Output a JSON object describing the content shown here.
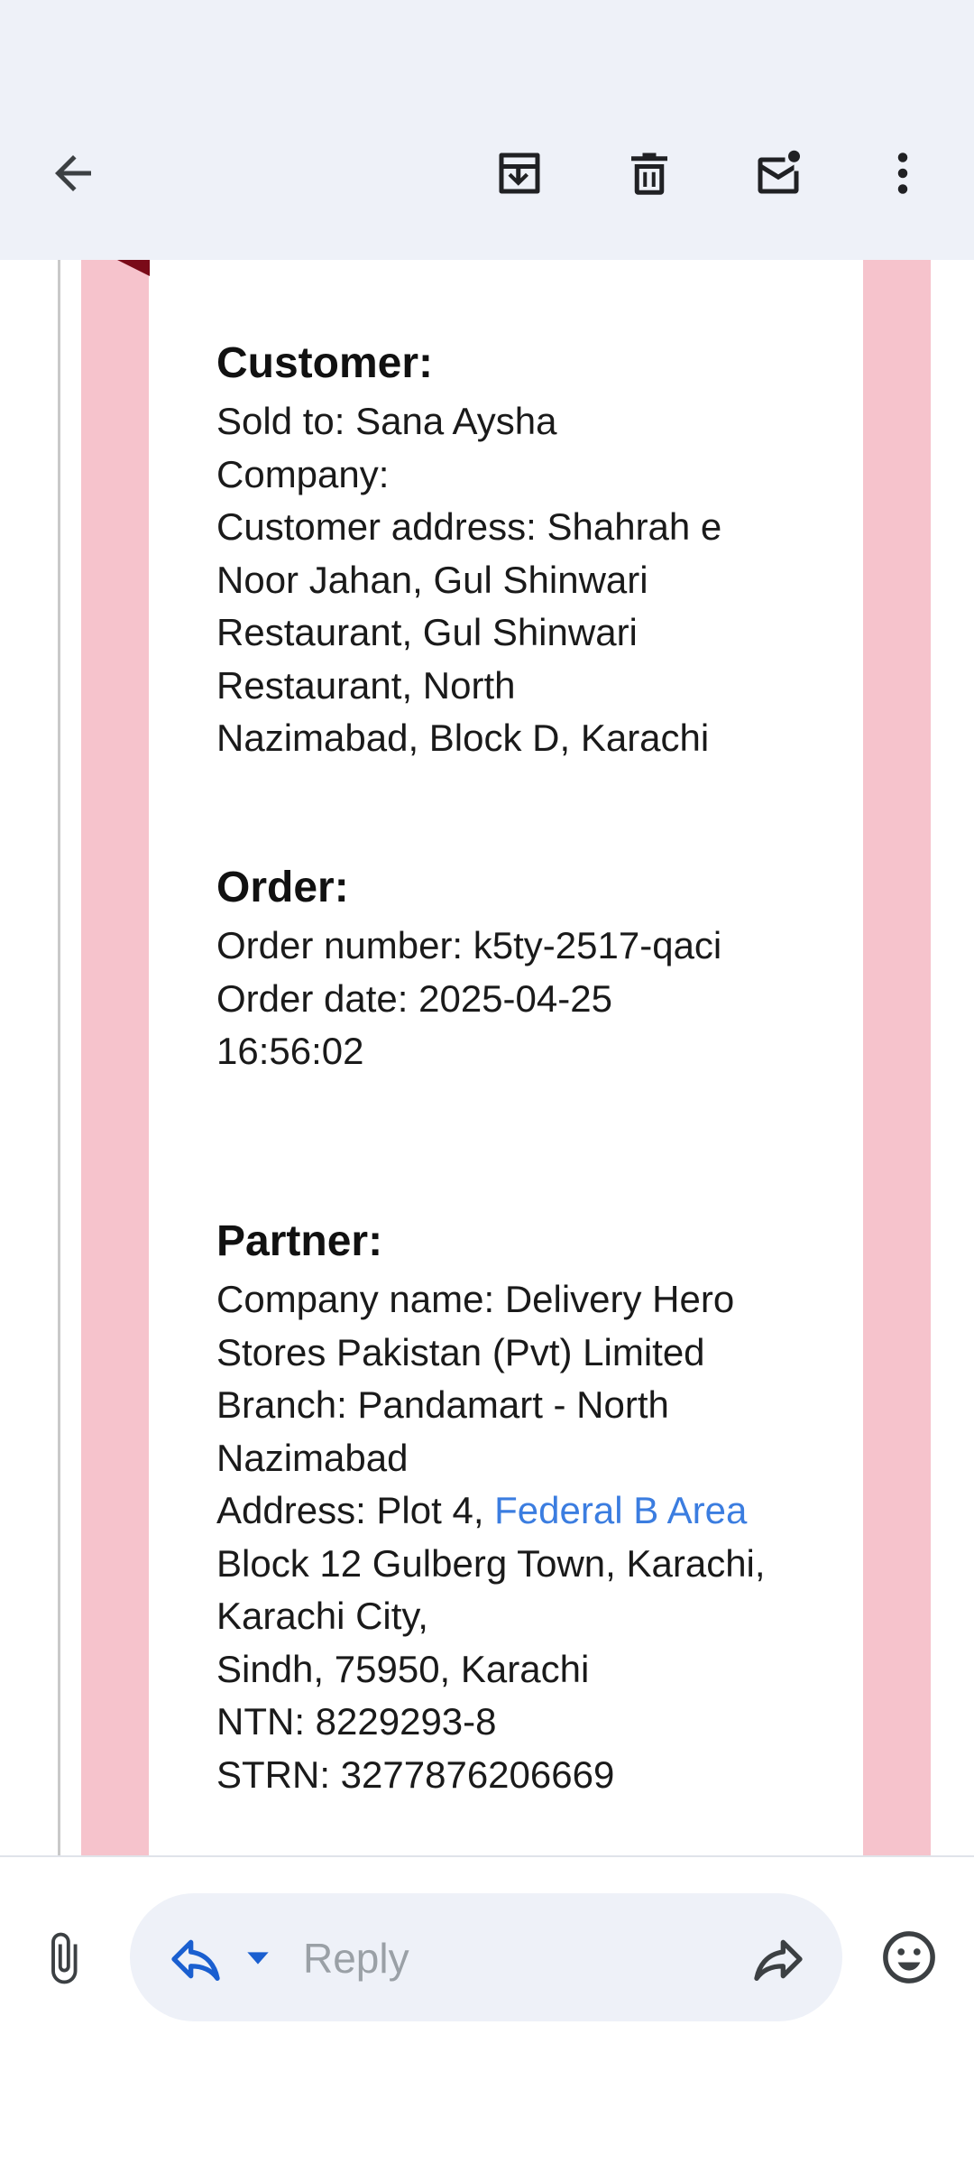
{
  "toolbar": {
    "back_icon": "arrow-back-icon",
    "archive_icon": "archive-icon",
    "delete_icon": "trash-icon",
    "mark_unread_icon": "mail-unread-icon",
    "more_icon": "more-vert-icon"
  },
  "email": {
    "customer": {
      "heading": "Customer:",
      "lines": [
        "Sold to: Sana Aysha",
        "Company:",
        "Customer address: Shahrah e",
        "Noor Jahan, Gul Shinwari",
        "Restaurant, Gul Shinwari",
        "Restaurant, North",
        "Nazimabad, Block D, Karachi"
      ]
    },
    "order": {
      "heading": "Order:",
      "lines": [
        "Order number: k5ty-2517-qaci",
        "Order date: 2025-04-25",
        "16:56:02"
      ]
    },
    "partner": {
      "heading": "Partner:",
      "lines": [
        "Company name: Delivery Hero",
        "Stores Pakistan (Pvt) Limited",
        "Branch: Pandamart - North",
        "Nazimabad"
      ],
      "address_prefix": "Address: Plot 4, ",
      "address_link_lines": [
        "Federal B Area",
        "Block 12 Gulberg Town, Karachi,",
        "Karachi City,",
        "Sindh, 75950, Karachi"
      ],
      "ntn": "NTN: 8229293-8",
      "strn": "STRN: 3277876206669"
    }
  },
  "reply_bar": {
    "placeholder": "Reply",
    "attach_icon": "paperclip-icon",
    "reply_icon": "reply-icon",
    "caret_icon": "caret-down-icon",
    "forward_icon": "forward-icon",
    "emoji_icon": "emoji-icon"
  },
  "colors": {
    "toolbar_bg": "#eef1f8",
    "pink_border": "#f6c3cc",
    "link": "#3b7de0",
    "accent_blue": "#1a5fd0"
  }
}
